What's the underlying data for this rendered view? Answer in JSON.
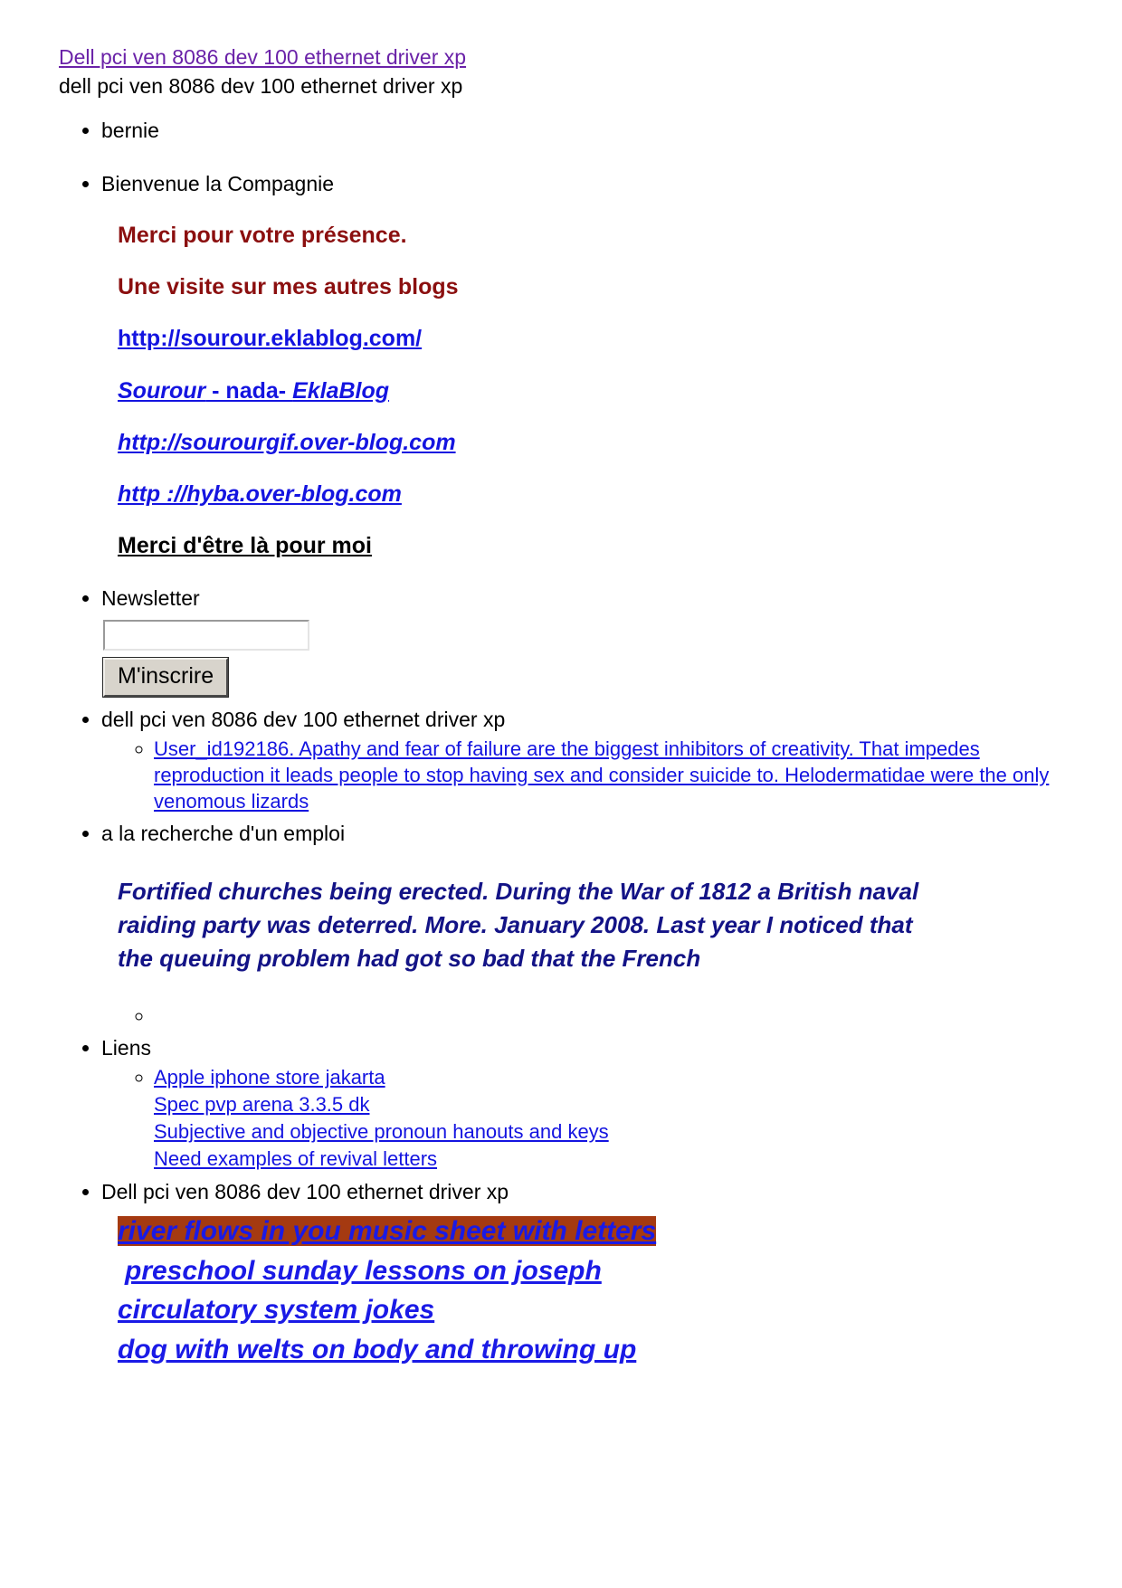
{
  "header": {
    "title_link": "Dell pci ven 8086 dev 100 ethernet driver xp",
    "subtitle": "dell pci ven 8086 dev 100 ethernet driver xp"
  },
  "list": {
    "item_bernie": "bernie",
    "item_bienvenue": "Bienvenue la Compagnie",
    "item_newsletter": "Newsletter",
    "item_dell_lower": "dell pci ven 8086 dev 100 ethernet driver xp",
    "item_emploi": "a la recherche d'un emploi",
    "item_liens": "Liens",
    "item_dell_upper": "Dell pci ven 8086 dev 100 ethernet driver xp"
  },
  "promo": {
    "thanks": "Merci pour votre présence.",
    "visit_blogs": "Une visite sur mes autres blogs",
    "url_eklablog": "http://sourour.eklablog.com/",
    "sourour_part1": "Sourour",
    "sourour_part2": " - nada- ",
    "sourour_part3": "EklaBlog",
    "url_sourourgif": "http://sourourgif.over-blog.com",
    "url_hyba": "http ://hyba.over-blog.com",
    "thanks_being_there": "Merci d'être là pour moi"
  },
  "newsletter": {
    "value": "",
    "placeholder": "",
    "submit_label": "M'inscrire"
  },
  "user_link": {
    "text": "User_id192186. Apathy and fear of failure are the biggest inhibitors of creativity. That impedes reproduction it leads people to stop having sex and consider suicide to. Helodermatidae were the only venomous lizards"
  },
  "fortified_paragraph": "Fortified churches being erected. During the War of 1812 a British naval raiding party was deterred. More. January 2008. Last year I noticed that the queuing problem had got so bad that the French",
  "empty_sub_bullet": "",
  "liens": [
    "Apple iphone store jakarta",
    "Spec pvp arena 3.3.5 dk",
    "Subjective and objective pronoun hanouts and keys",
    "Need examples of revival letters"
  ],
  "bottom_links": [
    "river flows in you music sheet with letters",
    "preschool sunday lessons on joseph",
    "circulatory system jokes",
    "dog with welts on body and throwing up"
  ],
  "colors": {
    "visited_link": "#6a22a8",
    "link_blue": "#1414e0",
    "dark_red_text": "#8b0f0f",
    "navy_text": "#131386",
    "highlight_background": "#a53a11",
    "button_face": "#d8d4cc",
    "page_background": "#ffffff"
  }
}
